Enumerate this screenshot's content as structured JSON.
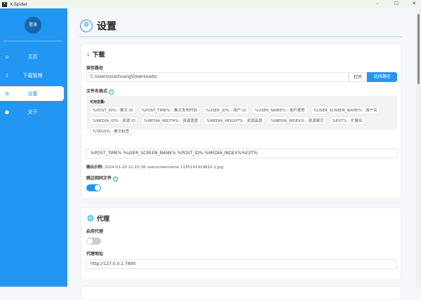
{
  "window": {
    "title": "X-Spider",
    "logo": "X",
    "minimize": "–",
    "maximize": "☐",
    "close": "✕"
  },
  "sidebar": {
    "login": "登录",
    "items": [
      {
        "label": "主页",
        "icon": "home-icon"
      },
      {
        "label": "下载管理",
        "icon": "download-icon"
      },
      {
        "label": "设置",
        "icon": "gear-icon",
        "active": true
      },
      {
        "label": "关于",
        "icon": "info-icon"
      }
    ]
  },
  "page": {
    "title": "设置"
  },
  "download": {
    "title": "下载",
    "save_path_label": "保存路径",
    "save_path": "C:\\Users\\xiashuang\\Downloads\\",
    "open_button": "打开",
    "choose_button": "选择路径",
    "filename_label": "文件名格式",
    "vars_title": "可用变量:",
    "vars": [
      "%POST_ID% - 推文 ID",
      "%POST_TIME% - 推文发布时间",
      "%USER_ID% - 用户 ID",
      "%USER_NAME% - 用户昵称",
      "%USER_SCREEN_NAME% - 用户名",
      "%MEDIA_ID% - 资源 ID",
      "%MEDIA_WIDTH% - 资源宽度",
      "%MEDIA_HEIGHT% - 资源高度",
      "%MEDIA_INDEX% - 资源索引",
      "%EXT% - 扩展名",
      "%TAGS% - 推文标签"
    ],
    "filename_format": "%POST_TIME% %USER_SCREEN_NAME% %POST_ID%-%MEDIA_INDEX%%EXT%",
    "example_label": "输出示例:",
    "example_value": "2024-01-20 21-15-36 userscreenname 1145141919810-1.jpg",
    "skip_label": "跳过相同文件",
    "skip_enabled": true
  },
  "proxy": {
    "title": "代理",
    "enable_label": "启用代理",
    "enabled": false,
    "address_label": "代理地址",
    "address": "http://127.0.0.1:7890"
  },
  "colors": {
    "accent": "#2196f3"
  }
}
